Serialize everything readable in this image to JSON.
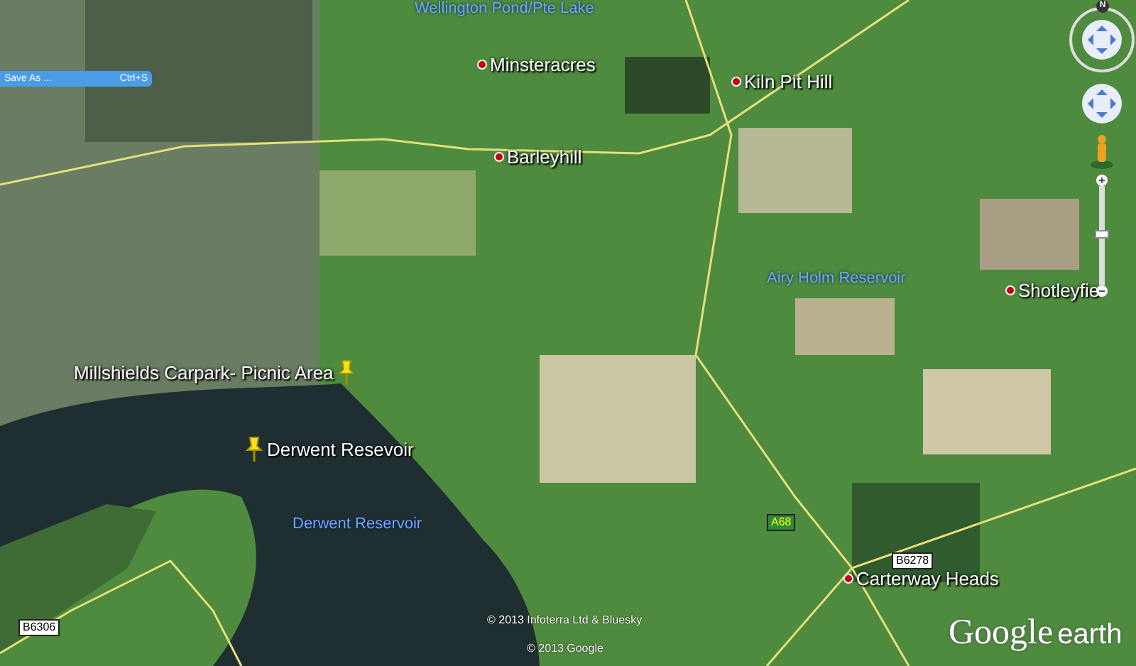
{
  "context_menu": {
    "items": [
      {
        "label": "Save As ...",
        "shortcut": "Ctrl+S",
        "selected": true
      }
    ]
  },
  "place_labels": [
    {
      "name": "Wellington Pond/Pte Lake",
      "kind": "water"
    },
    {
      "name": "Minsteracres",
      "kind": "place"
    },
    {
      "name": "Kiln Pit Hill",
      "kind": "place"
    },
    {
      "name": "Barleyhill",
      "kind": "place"
    },
    {
      "name": "Airy Holm Reservoir",
      "kind": "water"
    },
    {
      "name": "Shotleyfie",
      "kind": "place"
    },
    {
      "name": "Millshields Carpark- Picnic  Area",
      "kind": "pushpin"
    },
    {
      "name": "Derwent Resevoir",
      "kind": "pushpin"
    },
    {
      "name": "Derwent Reservoir",
      "kind": "water"
    },
    {
      "name": "Carterway Heads",
      "kind": "place"
    }
  ],
  "road_shields": [
    {
      "label": "A68",
      "kind": "primary"
    },
    {
      "label": "B6278",
      "kind": "minor"
    },
    {
      "label": "B6306",
      "kind": "minor"
    }
  ],
  "navigation": {
    "north": "N",
    "zoom": {
      "level": 0.52
    }
  },
  "attribution": [
    "© 2013 Infoterra Ltd & Bluesky",
    "© 2013 Google"
  ],
  "logo": {
    "word": "Google",
    "product": "earth"
  }
}
